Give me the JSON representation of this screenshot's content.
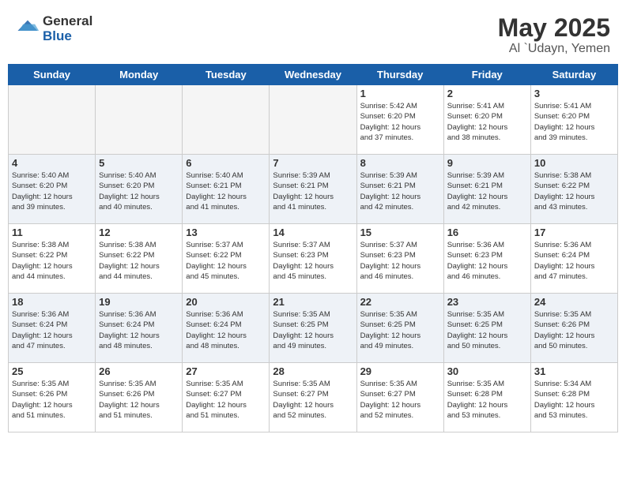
{
  "header": {
    "logo": {
      "general": "General",
      "blue": "Blue"
    },
    "month": "May 2025",
    "location": "Al `Udayn, Yemen"
  },
  "weekdays": [
    "Sunday",
    "Monday",
    "Tuesday",
    "Wednesday",
    "Thursday",
    "Friday",
    "Saturday"
  ],
  "weeks": [
    [
      {
        "day": "",
        "info": ""
      },
      {
        "day": "",
        "info": ""
      },
      {
        "day": "",
        "info": ""
      },
      {
        "day": "",
        "info": ""
      },
      {
        "day": "1",
        "info": "Sunrise: 5:42 AM\nSunset: 6:20 PM\nDaylight: 12 hours\nand 37 minutes."
      },
      {
        "day": "2",
        "info": "Sunrise: 5:41 AM\nSunset: 6:20 PM\nDaylight: 12 hours\nand 38 minutes."
      },
      {
        "day": "3",
        "info": "Sunrise: 5:41 AM\nSunset: 6:20 PM\nDaylight: 12 hours\nand 39 minutes."
      }
    ],
    [
      {
        "day": "4",
        "info": "Sunrise: 5:40 AM\nSunset: 6:20 PM\nDaylight: 12 hours\nand 39 minutes."
      },
      {
        "day": "5",
        "info": "Sunrise: 5:40 AM\nSunset: 6:20 PM\nDaylight: 12 hours\nand 40 minutes."
      },
      {
        "day": "6",
        "info": "Sunrise: 5:40 AM\nSunset: 6:21 PM\nDaylight: 12 hours\nand 41 minutes."
      },
      {
        "day": "7",
        "info": "Sunrise: 5:39 AM\nSunset: 6:21 PM\nDaylight: 12 hours\nand 41 minutes."
      },
      {
        "day": "8",
        "info": "Sunrise: 5:39 AM\nSunset: 6:21 PM\nDaylight: 12 hours\nand 42 minutes."
      },
      {
        "day": "9",
        "info": "Sunrise: 5:39 AM\nSunset: 6:21 PM\nDaylight: 12 hours\nand 42 minutes."
      },
      {
        "day": "10",
        "info": "Sunrise: 5:38 AM\nSunset: 6:22 PM\nDaylight: 12 hours\nand 43 minutes."
      }
    ],
    [
      {
        "day": "11",
        "info": "Sunrise: 5:38 AM\nSunset: 6:22 PM\nDaylight: 12 hours\nand 44 minutes."
      },
      {
        "day": "12",
        "info": "Sunrise: 5:38 AM\nSunset: 6:22 PM\nDaylight: 12 hours\nand 44 minutes."
      },
      {
        "day": "13",
        "info": "Sunrise: 5:37 AM\nSunset: 6:22 PM\nDaylight: 12 hours\nand 45 minutes."
      },
      {
        "day": "14",
        "info": "Sunrise: 5:37 AM\nSunset: 6:23 PM\nDaylight: 12 hours\nand 45 minutes."
      },
      {
        "day": "15",
        "info": "Sunrise: 5:37 AM\nSunset: 6:23 PM\nDaylight: 12 hours\nand 46 minutes."
      },
      {
        "day": "16",
        "info": "Sunrise: 5:36 AM\nSunset: 6:23 PM\nDaylight: 12 hours\nand 46 minutes."
      },
      {
        "day": "17",
        "info": "Sunrise: 5:36 AM\nSunset: 6:24 PM\nDaylight: 12 hours\nand 47 minutes."
      }
    ],
    [
      {
        "day": "18",
        "info": "Sunrise: 5:36 AM\nSunset: 6:24 PM\nDaylight: 12 hours\nand 47 minutes."
      },
      {
        "day": "19",
        "info": "Sunrise: 5:36 AM\nSunset: 6:24 PM\nDaylight: 12 hours\nand 48 minutes."
      },
      {
        "day": "20",
        "info": "Sunrise: 5:36 AM\nSunset: 6:24 PM\nDaylight: 12 hours\nand 48 minutes."
      },
      {
        "day": "21",
        "info": "Sunrise: 5:35 AM\nSunset: 6:25 PM\nDaylight: 12 hours\nand 49 minutes."
      },
      {
        "day": "22",
        "info": "Sunrise: 5:35 AM\nSunset: 6:25 PM\nDaylight: 12 hours\nand 49 minutes."
      },
      {
        "day": "23",
        "info": "Sunrise: 5:35 AM\nSunset: 6:25 PM\nDaylight: 12 hours\nand 50 minutes."
      },
      {
        "day": "24",
        "info": "Sunrise: 5:35 AM\nSunset: 6:26 PM\nDaylight: 12 hours\nand 50 minutes."
      }
    ],
    [
      {
        "day": "25",
        "info": "Sunrise: 5:35 AM\nSunset: 6:26 PM\nDaylight: 12 hours\nand 51 minutes."
      },
      {
        "day": "26",
        "info": "Sunrise: 5:35 AM\nSunset: 6:26 PM\nDaylight: 12 hours\nand 51 minutes."
      },
      {
        "day": "27",
        "info": "Sunrise: 5:35 AM\nSunset: 6:27 PM\nDaylight: 12 hours\nand 51 minutes."
      },
      {
        "day": "28",
        "info": "Sunrise: 5:35 AM\nSunset: 6:27 PM\nDaylight: 12 hours\nand 52 minutes."
      },
      {
        "day": "29",
        "info": "Sunrise: 5:35 AM\nSunset: 6:27 PM\nDaylight: 12 hours\nand 52 minutes."
      },
      {
        "day": "30",
        "info": "Sunrise: 5:35 AM\nSunset: 6:28 PM\nDaylight: 12 hours\nand 53 minutes."
      },
      {
        "day": "31",
        "info": "Sunrise: 5:34 AM\nSunset: 6:28 PM\nDaylight: 12 hours\nand 53 minutes."
      }
    ]
  ]
}
